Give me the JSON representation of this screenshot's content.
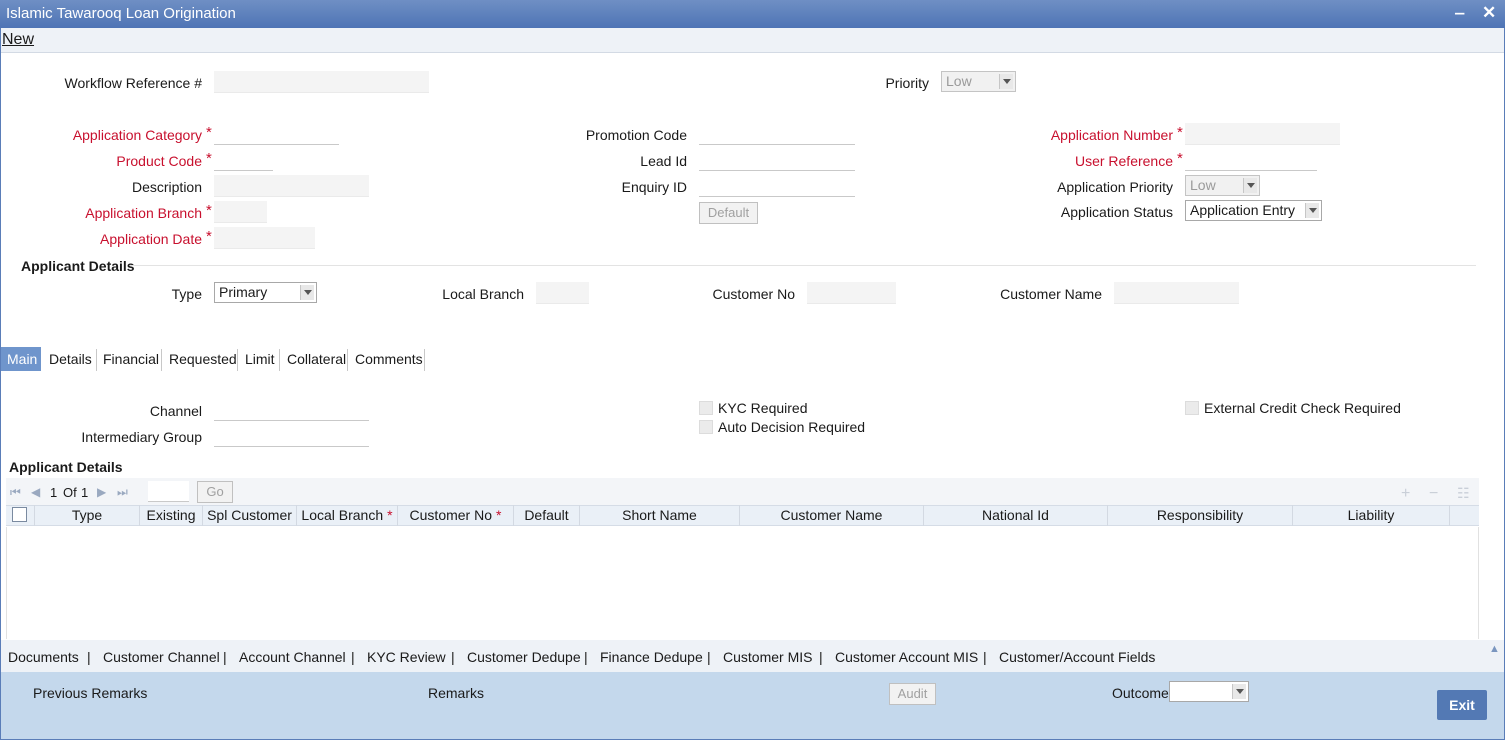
{
  "window": {
    "title": "Islamic Tawarooq Loan Origination",
    "minimize_glyph": "‒",
    "close_glyph": "✕"
  },
  "menu": {
    "new_label": "New"
  },
  "header": {
    "workflow_ref_label": "Workflow Reference #",
    "priority_label": "Priority",
    "priority_value": "Low"
  },
  "left": {
    "application_category_label": "Application Category",
    "product_code_label": "Product Code",
    "description_label": "Description",
    "application_branch_label": "Application Branch",
    "application_date_label": "Application Date"
  },
  "middle": {
    "promotion_code_label": "Promotion Code",
    "lead_id_label": "Lead Id",
    "enquiry_id_label": "Enquiry ID",
    "default_button": "Default"
  },
  "right": {
    "application_number_label": "Application Number",
    "user_reference_label": "User Reference",
    "application_priority_label": "Application Priority",
    "application_priority_value": "Low",
    "application_status_label": "Application Status",
    "application_status_value": "Application Entry"
  },
  "applicant": {
    "section_title": "Applicant Details",
    "type_label": "Type",
    "type_value": "Primary",
    "local_branch_label": "Local Branch",
    "customer_no_label": "Customer No",
    "customer_name_label": "Customer Name"
  },
  "tabs": [
    "Main",
    "Details",
    "Financial",
    "Requested",
    "Limit",
    "Collateral",
    "Comments"
  ],
  "main_tab": {
    "channel_label": "Channel",
    "intermediary_group_label": "Intermediary Group",
    "kyc_required_label": "KYC Required",
    "auto_decision_label": "Auto Decision Required",
    "external_credit_label": "External Credit Check Required"
  },
  "grid": {
    "section_title": "Applicant Details",
    "pager": {
      "page": "1",
      "of_label": "Of",
      "total": "1",
      "go_label": "Go"
    },
    "columns": [
      "Type",
      "Existing",
      "Spl Customer",
      "Local Branch",
      "Customer No",
      "Default",
      "Short Name",
      "Customer Name",
      "National Id",
      "Responsibility",
      "Liability"
    ],
    "required_marker": "*"
  },
  "bottom_links": [
    "Documents",
    "Customer Channel",
    "Account Channel",
    "KYC Review",
    "Customer Dedupe",
    "Finance Dedupe",
    "Customer MIS",
    "Customer Account MIS",
    "Customer/Account Fields"
  ],
  "link_separator": "|",
  "footer": {
    "previous_remarks_label": "Previous Remarks",
    "remarks_label": "Remarks",
    "audit_button": "Audit",
    "outcome_label": "Outcome",
    "exit_button": "Exit"
  },
  "colors": {
    "title_bar": "#5b7fbd",
    "required": "#c8102e",
    "active_tab": "#6f95cc",
    "footer": "#c4d8ec",
    "exit_button": "#5379b4"
  }
}
